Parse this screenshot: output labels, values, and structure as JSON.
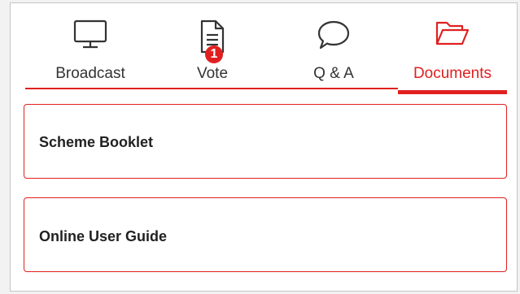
{
  "colors": {
    "accent": "#e02020",
    "text": "#333333",
    "border": "#c4c4c4"
  },
  "tabs": [
    {
      "label": "Broadcast",
      "icon": "monitor-icon",
      "active": false
    },
    {
      "label": "Vote",
      "icon": "document-icon",
      "active": false,
      "badge": "1"
    },
    {
      "label": "Q & A",
      "icon": "speech-bubble-icon",
      "active": false
    },
    {
      "label": "Documents",
      "icon": "folder-open-icon",
      "active": true
    }
  ],
  "documents": [
    {
      "title": "Scheme Booklet"
    },
    {
      "title": "Online User Guide"
    }
  ]
}
